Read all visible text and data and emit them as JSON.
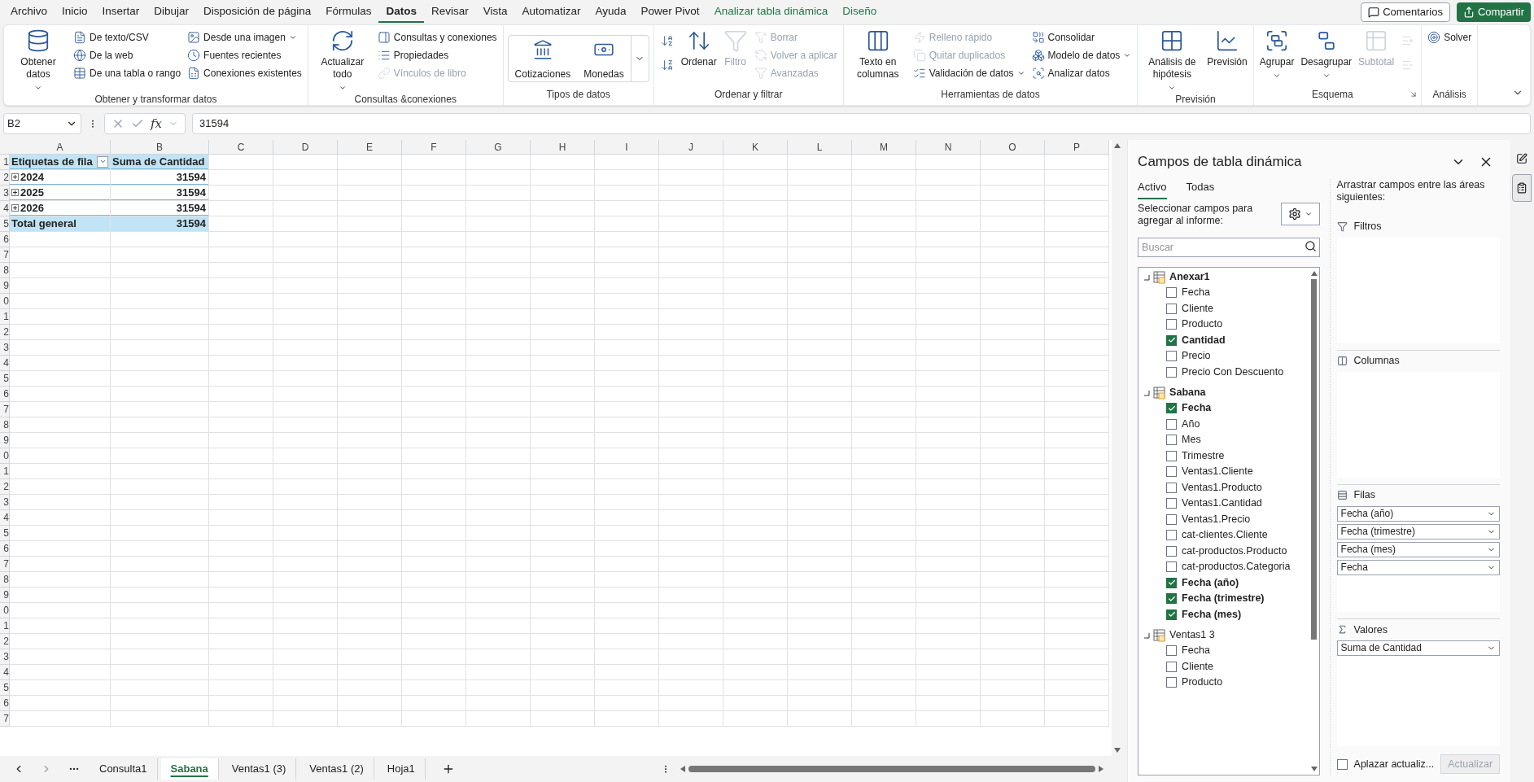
{
  "menu_tabs": [
    {
      "label": "Archivo",
      "selected": false,
      "contextual": false
    },
    {
      "label": "Inicio",
      "selected": false,
      "contextual": false
    },
    {
      "label": "Insertar",
      "selected": false,
      "contextual": false
    },
    {
      "label": "Dibujar",
      "selected": false,
      "contextual": false
    },
    {
      "label": "Disposición de página",
      "selected": false,
      "contextual": false
    },
    {
      "label": "Fórmulas",
      "selected": false,
      "contextual": false
    },
    {
      "label": "Datos",
      "selected": true,
      "contextual": false
    },
    {
      "label": "Revisar",
      "selected": false,
      "contextual": false
    },
    {
      "label": "Vista",
      "selected": false,
      "contextual": false
    },
    {
      "label": "Automatizar",
      "selected": false,
      "contextual": false
    },
    {
      "label": "Ayuda",
      "selected": false,
      "contextual": false
    },
    {
      "label": "Power Pivot",
      "selected": false,
      "contextual": false
    },
    {
      "label": "Analizar tabla dinámica",
      "selected": false,
      "contextual": true
    },
    {
      "label": "Diseño",
      "selected": false,
      "contextual": true
    }
  ],
  "header_buttons": [
    {
      "label": "Comentarios",
      "kind": "outline"
    },
    {
      "label": "Compartir",
      "kind": "primary"
    }
  ],
  "ribbon": {
    "groups": [
      {
        "label": "Obtener y transformar datos",
        "kind": "normal",
        "columns": [
          [
            {
              "kind": "large",
              "label": "Obtener datos",
              "menu": true,
              "disabled": false
            }
          ],
          [
            {
              "kind": "small",
              "label": "De texto/CSV",
              "menu": false,
              "disabled": false
            },
            {
              "kind": "small",
              "label": "De la web",
              "menu": false,
              "disabled": false
            },
            {
              "kind": "small",
              "label": "De una tabla o rango",
              "menu": false,
              "disabled": false
            }
          ],
          [
            {
              "kind": "small",
              "label": "Desde una imagen",
              "menu": true,
              "disabled": false
            },
            {
              "kind": "small",
              "label": "Fuentes recientes",
              "menu": false,
              "disabled": false
            },
            {
              "kind": "small",
              "label": "Conexiones existentes",
              "menu": false,
              "disabled": false
            }
          ]
        ]
      },
      {
        "label": "Consultas &conexiones",
        "kind": "normal",
        "columns": [
          [
            {
              "kind": "large",
              "label": "Actualizar todo",
              "menu": true,
              "disabled": false
            }
          ],
          [
            {
              "kind": "small",
              "label": "Consultas y conexiones",
              "menu": false,
              "disabled": false
            },
            {
              "kind": "small",
              "label": "Propiedades",
              "menu": false,
              "disabled": false
            },
            {
              "kind": "small",
              "label": "Vínculos de libro",
              "menu": false,
              "disabled": true
            }
          ]
        ]
      },
      {
        "label": "Tipos de datos",
        "kind": "gallery",
        "columns": [
          [
            {
              "kind": "tile",
              "label": "Cotizaciones",
              "menu": false,
              "disabled": false
            }
          ],
          [
            {
              "kind": "tile",
              "label": "Monedas",
              "menu": false,
              "disabled": false
            }
          ]
        ]
      },
      {
        "label": "Ordenar y filtrar",
        "kind": "normal",
        "columns": [
          [
            {
              "kind": "icon",
              "menu": false,
              "disabled": false
            },
            {
              "kind": "icon",
              "menu": false,
              "disabled": false
            }
          ],
          [
            {
              "kind": "large",
              "label": "Ordenar",
              "menu": false,
              "disabled": false
            }
          ],
          [
            {
              "kind": "large",
              "label": "Filtro",
              "menu": false,
              "disabled": true
            }
          ],
          [
            {
              "kind": "small",
              "label": "Borrar",
              "menu": false,
              "disabled": true
            },
            {
              "kind": "small",
              "label": "Volver a aplicar",
              "menu": false,
              "disabled": true
            },
            {
              "kind": "small",
              "label": "Avanzadas",
              "menu": false,
              "disabled": true
            }
          ]
        ]
      },
      {
        "label": "Herramientas de datos",
        "kind": "normal",
        "columns": [
          [
            {
              "kind": "large",
              "label": "Texto en columnas",
              "menu": false,
              "disabled": false
            }
          ],
          [
            {
              "kind": "small",
              "label": "Relleno rápido",
              "menu": false,
              "disabled": true
            },
            {
              "kind": "small",
              "label": "Quitar duplicados",
              "menu": false,
              "disabled": true
            },
            {
              "kind": "small",
              "label": "Validación de datos",
              "menu": true,
              "disabled": false
            }
          ],
          [
            {
              "kind": "small",
              "label": "Consolidar",
              "menu": false,
              "disabled": false
            },
            {
              "kind": "small",
              "label": "Modelo de datos",
              "menu": true,
              "disabled": false
            },
            {
              "kind": "small",
              "label": "Analizar datos",
              "menu": false,
              "disabled": false
            }
          ]
        ]
      },
      {
        "label": "Previsión",
        "kind": "normal",
        "columns": [
          [
            {
              "kind": "large",
              "label": "Análisis de hipótesis",
              "menu": true,
              "disabled": false
            }
          ],
          [
            {
              "kind": "large",
              "label": "Previsión",
              "menu": false,
              "disabled": false
            }
          ]
        ]
      },
      {
        "label": "Esquema",
        "kind": "normal",
        "launcher": true,
        "columns": [
          [
            {
              "kind": "large",
              "label": "Agrupar",
              "menu": true,
              "disabled": false
            }
          ],
          [
            {
              "kind": "large",
              "label": "Desagrupar",
              "menu": true,
              "disabled": false
            }
          ],
          [
            {
              "kind": "large",
              "label": "Subtotal",
              "menu": false,
              "disabled": true
            }
          ],
          [
            {
              "kind": "icon",
              "menu": false,
              "disabled": true
            },
            {
              "kind": "icon",
              "menu": false,
              "disabled": true
            }
          ]
        ]
      },
      {
        "label": "Análisis",
        "kind": "normal",
        "columns": [
          [
            {
              "kind": "small",
              "label": "Solver",
              "menu": false,
              "disabled": false
            }
          ]
        ]
      }
    ]
  },
  "formula_bar": {
    "name_box": "B2",
    "fx_label": "fx",
    "formula": "31594"
  },
  "sheet": {
    "columns": [
      "A",
      "B",
      "C",
      "D",
      "E",
      "F",
      "G",
      "H",
      "I",
      "J",
      "K",
      "L",
      "M",
      "N",
      "O",
      "P"
    ],
    "row_numbers": [
      "1",
      "2",
      "3",
      "4",
      "5",
      "6",
      "7",
      "8",
      "9",
      "0",
      "1",
      "2",
      "3",
      "4",
      "5",
      "6",
      "7",
      "8",
      "9",
      "0",
      "1",
      "2",
      "3",
      "4",
      "5",
      "6",
      "7",
      "8",
      "9",
      "0",
      "1",
      "2",
      "3",
      "4",
      "5",
      "6",
      "7"
    ]
  },
  "pivot_table": {
    "row_label": "Etiquetas de fila",
    "value_label": "Suma de Cantidad",
    "rows": [
      {
        "label": "2024",
        "value": "31594",
        "collapsed": true
      },
      {
        "label": "2025",
        "value": "31594",
        "collapsed": true
      },
      {
        "label": "2026",
        "value": "31594",
        "collapsed": true
      }
    ],
    "total_label": "Total general",
    "total_value": "31594"
  },
  "sheet_tabs": [
    {
      "label": "Consulta1",
      "selected": false
    },
    {
      "label": "Sabana",
      "selected": true
    },
    {
      "label": "Ventas1 (3)",
      "selected": false
    },
    {
      "label": "Ventas1 (2)",
      "selected": false
    },
    {
      "label": "Hoja1",
      "selected": false
    }
  ],
  "pivot_panel": {
    "title": "Campos de tabla dinámica",
    "tabs": [
      {
        "label": "Activo",
        "selected": true
      },
      {
        "label": "Todas",
        "selected": false
      }
    ],
    "instructions": "Seleccionar campos para agregar al informe:",
    "search": {
      "placeholder": "Buscar"
    },
    "tables": [
      {
        "name": "Anexar1",
        "expanded": true,
        "fields": [
          {
            "name": "Fecha",
            "checked": false
          },
          {
            "name": "Cliente",
            "checked": false
          },
          {
            "name": "Producto",
            "checked": false
          },
          {
            "name": "Cantidad",
            "checked": true
          },
          {
            "name": "Precio",
            "checked": false
          },
          {
            "name": "Precio Con Descuento",
            "checked": false
          }
        ]
      },
      {
        "name": "Sabana",
        "expanded": true,
        "fields": [
          {
            "name": "Fecha",
            "checked": true
          },
          {
            "name": "Año",
            "checked": false
          },
          {
            "name": "Mes",
            "checked": false
          },
          {
            "name": "Trimestre",
            "checked": false
          },
          {
            "name": "Ventas1.Cliente",
            "checked": false
          },
          {
            "name": "Ventas1.Producto",
            "checked": false
          },
          {
            "name": "Ventas1.Cantidad",
            "checked": false
          },
          {
            "name": "Ventas1.Precio",
            "checked": false
          },
          {
            "name": "cat-clientes.Cliente",
            "checked": false
          },
          {
            "name": "cat-productos.Producto",
            "checked": false
          },
          {
            "name": "cat-productos.Categoria",
            "checked": false
          },
          {
            "name": "Fecha (año)",
            "checked": true
          },
          {
            "name": "Fecha (trimestre)",
            "checked": true
          },
          {
            "name": "Fecha (mes)",
            "checked": true
          }
        ]
      },
      {
        "name": "Ventas1 3",
        "expanded": true,
        "fields": [
          {
            "name": "Fecha",
            "checked": false
          },
          {
            "name": "Cliente",
            "checked": false
          },
          {
            "name": "Producto",
            "checked": false
          }
        ]
      }
    ],
    "areas_hint": "Arrastrar campos entre las áreas siguientes:",
    "areas": [
      {
        "label": "Filtros"
      },
      {
        "label": "Columnas"
      },
      {
        "label": "Filas",
        "fields": [
          "Fecha (año)",
          "Fecha (trimestre)",
          "Fecha (mes)",
          "Fecha"
        ]
      },
      {
        "label": "Valores",
        "fields": [
          "Suma de Cantidad"
        ]
      }
    ],
    "defer": {
      "label": "Aplazar actualiz...",
      "checked": false
    },
    "update_button": {
      "label": "Actualizar",
      "disabled": true
    }
  }
}
